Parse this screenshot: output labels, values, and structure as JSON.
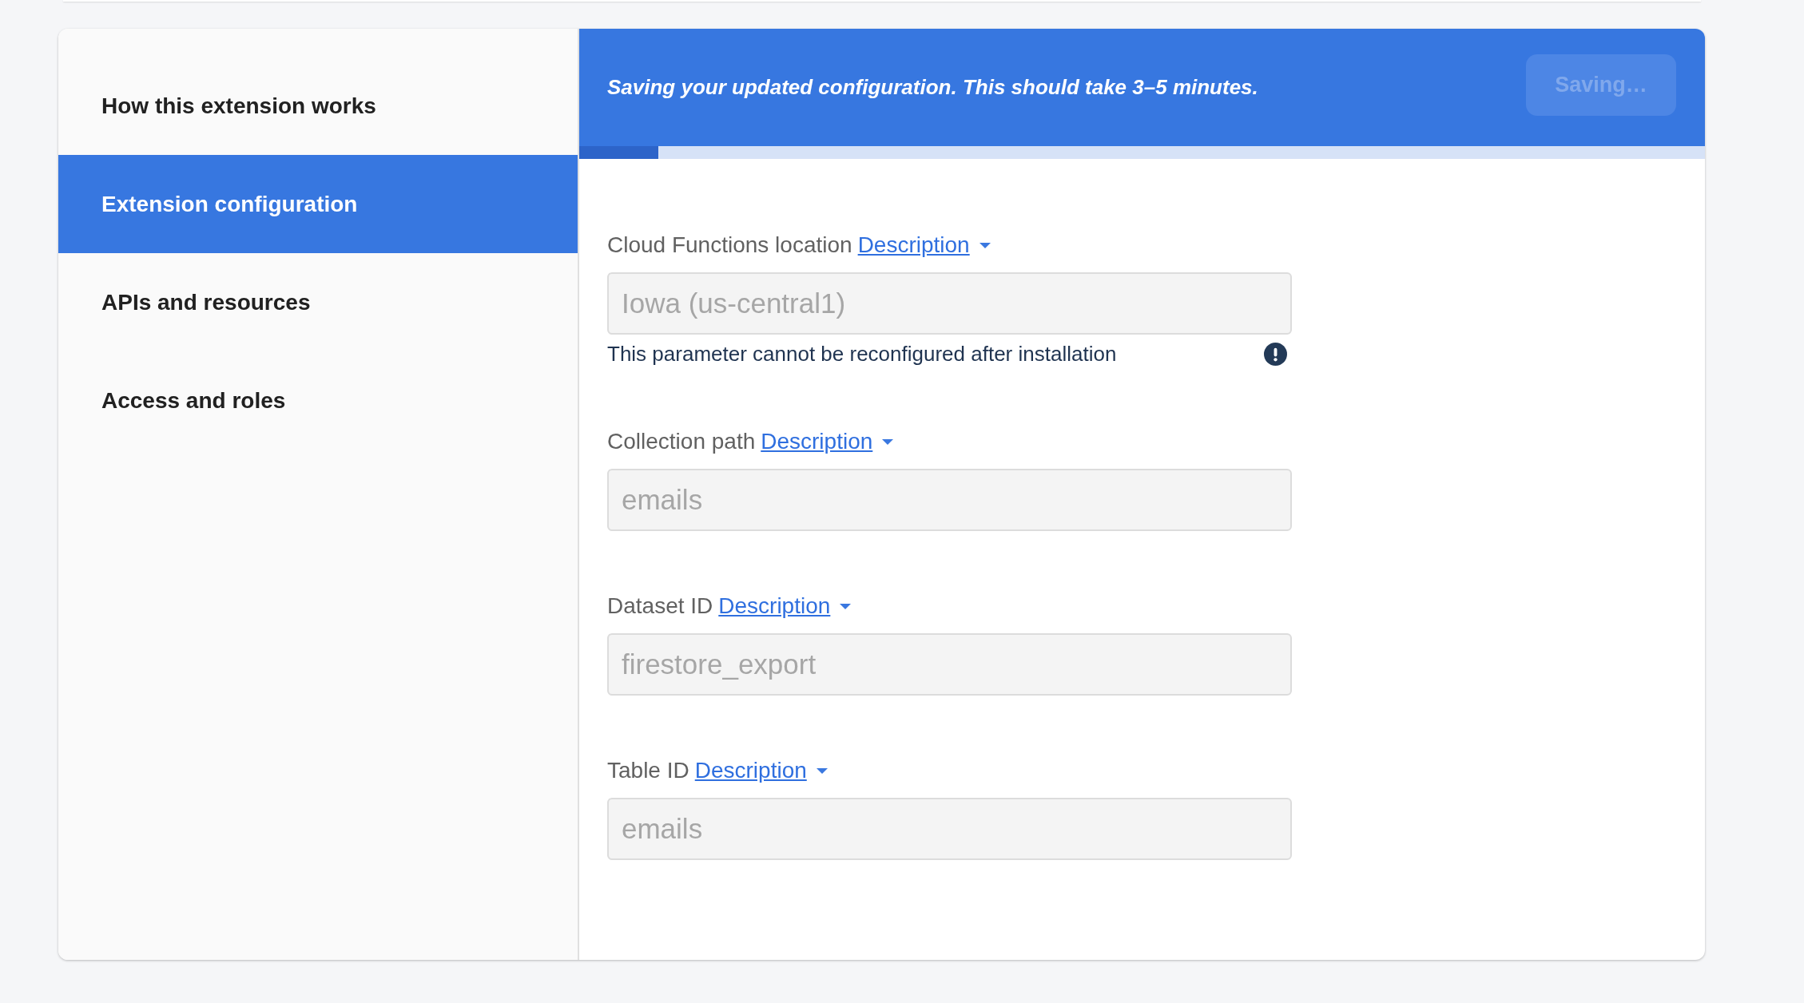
{
  "sidebar": {
    "items": [
      {
        "label": "How this extension works",
        "selected": false
      },
      {
        "label": "Extension configuration",
        "selected": true
      },
      {
        "label": "APIs and resources",
        "selected": false
      },
      {
        "label": "Access and roles",
        "selected": false
      }
    ]
  },
  "banner": {
    "message": "Saving your updated configuration. This should take 3–5 minutes.",
    "button": {
      "label": "Saving…",
      "disabled": true
    },
    "progress": {
      "level": 0.07
    }
  },
  "fields": [
    {
      "label": "Cloud Functions location",
      "link": "Description",
      "value": "Iowa (us-central1)",
      "disabled": true,
      "helper": "This parameter cannot be reconfigured after installation"
    },
    {
      "label": "Collection path",
      "link": "Description",
      "value": "emails",
      "disabled": true
    },
    {
      "label": "Dataset ID",
      "link": "Description",
      "value": "firestore_export",
      "disabled": true
    },
    {
      "label": "Table ID",
      "link": "Description",
      "value": "emails",
      "disabled": true
    }
  ]
}
